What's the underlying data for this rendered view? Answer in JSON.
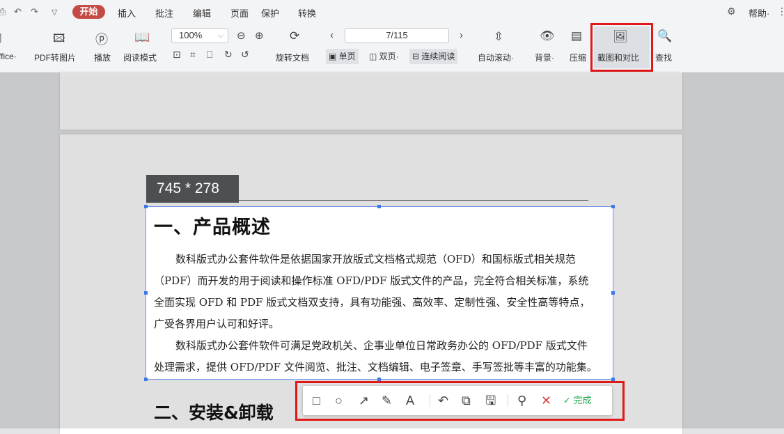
{
  "menu": {
    "active_tab": "开始",
    "tabs": [
      "插入",
      "批注",
      "编辑",
      "页面",
      "保护",
      "转换"
    ],
    "help": "帮助·"
  },
  "toolbar": {
    "office_label": "ffice·",
    "pdf_to_image": "PDF转图片",
    "play": "播放",
    "reading_mode": "阅读模式",
    "zoom_value": "100%",
    "rotate_doc": "旋转文档",
    "page_indicator": "7/115",
    "single_page": "单页",
    "double_page": "双页·",
    "continuous": "连续阅读",
    "auto_scroll": "自动滚动·",
    "background": "背景·",
    "compress": "压缩",
    "screenshot_compare": "截图和对比",
    "find": "查找"
  },
  "capture": {
    "size": "745 * 278"
  },
  "document": {
    "heading1": "一、产品概述",
    "para_lines": [
      "数科版式办公套件软件是依据国家开放版式文档格式规范（OFD）和国标版式相关规范",
      "（PDF）而开发的用于阅读和操作标准 OFD/PDF 版式文件的产品，完全符合相关标准，系统",
      "全面实现 OFD 和 PDF 版式文档双支持，具有功能强、高效率、定制性强、安全性高等特点，",
      "广受各界用户认可和好评。",
      "数科版式办公套件软件可满足党政机关、企事业单位日常政务办公的 OFD/PDF 版式文件",
      "处理需求，提供 OFD/PDF 文件阅览、批注、文档编辑、电子签章、手写签批等丰富的功能集。"
    ],
    "heading2": "二、安装&卸载"
  },
  "annot_toolbar": {
    "done_label": "完成"
  },
  "colors": {
    "accent_red": "#c44a45",
    "highlight_red": "#e01818",
    "selection_blue": "#3d7ae8",
    "done_green": "#1fa84d"
  }
}
